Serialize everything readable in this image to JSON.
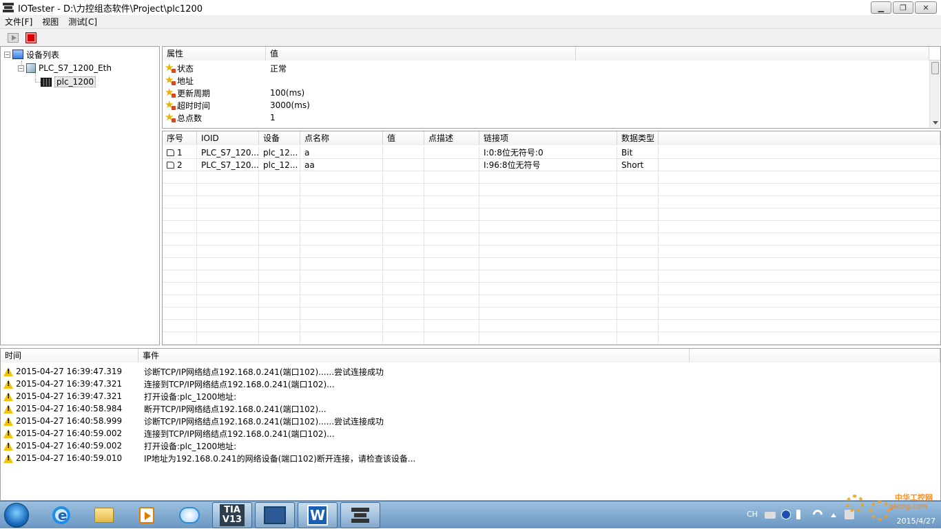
{
  "window": {
    "title": "IOTester - D:\\力控组态软件\\Project\\plc1200",
    "min_label": "▁",
    "max_label": "❐",
    "close_label": "✕"
  },
  "menu": [
    "文件[F]",
    "视图",
    "测试[C]"
  ],
  "toolbar": {
    "start_icon": "start-io-icon",
    "stop_icon": "stop-icon"
  },
  "tree": {
    "root": "设备列表",
    "channel": "PLC_S7_1200_Eth",
    "device": "plc_1200"
  },
  "properties": {
    "headers": [
      "属性",
      "值"
    ],
    "rows": [
      {
        "name": "状态",
        "value": "正常"
      },
      {
        "name": "地址",
        "value": ""
      },
      {
        "name": "更新周期",
        "value": "100(ms)"
      },
      {
        "name": "超时时间",
        "value": "3000(ms)"
      },
      {
        "name": "总点数",
        "value": "1"
      }
    ]
  },
  "points": {
    "headers": [
      "序号",
      "IOID",
      "设备",
      "点名称",
      "值",
      "点描述",
      "链接项",
      "数据类型"
    ],
    "rows": [
      [
        "1",
        "PLC_S7_120...",
        "plc_12...",
        "a",
        "",
        "",
        "I:0:8位无符号:0",
        "Bit"
      ],
      [
        "2",
        "PLC_S7_120...",
        "plc_12...",
        "aa",
        "",
        "",
        "I:96:8位无符号",
        "Short"
      ]
    ]
  },
  "log": {
    "headers": [
      "时间",
      "事件"
    ],
    "rows": [
      {
        "time": "2015-04-27 16:39:47.319",
        "event": "诊断TCP/IP网络结点192.168.0.241(端口102)......尝试连接成功"
      },
      {
        "time": "2015-04-27 16:39:47.321",
        "event": "连接到TCP/IP网络结点192.168.0.241(端口102)..."
      },
      {
        "time": "2015-04-27 16:39:47.321",
        "event": "打开设备:plc_1200地址:"
      },
      {
        "time": "2015-04-27 16:40:58.984",
        "event": "断开TCP/IP网络结点192.168.0.241(端口102)..."
      },
      {
        "time": "2015-04-27 16:40:58.999",
        "event": "诊断TCP/IP网络结点192.168.0.241(端口102)......尝试连接成功"
      },
      {
        "time": "2015-04-27 16:40:59.002",
        "event": "连接到TCP/IP网络结点192.168.0.241(端口102)..."
      },
      {
        "time": "2015-04-27 16:40:59.002",
        "event": "打开设备:plc_1200地址:"
      },
      {
        "time": "2015-04-27 16:40:59.010",
        "event": "IP地址为192.168.0.241的网络设备(端口102)断开连接，请检查该设备..."
      }
    ]
  },
  "taskbar": {
    "apps": [
      "internet-explorer-icon",
      "file-explorer-icon",
      "media-player-icon",
      "cloud-icon",
      "tia-portal-icon",
      "screen-icon",
      "word-icon",
      "iotester-icon"
    ],
    "tia_label_1": "TIA",
    "tia_label_2": "V13",
    "word_label": "W",
    "ime": "CH",
    "date": "2015/4/27",
    "watermark": "中华工控网",
    "watermark_url": "gkong.com"
  },
  "colors": {
    "stop_red": "#d90000",
    "warning_yellow": "#f5c400",
    "taskbar_blue": "#6a97c2"
  }
}
